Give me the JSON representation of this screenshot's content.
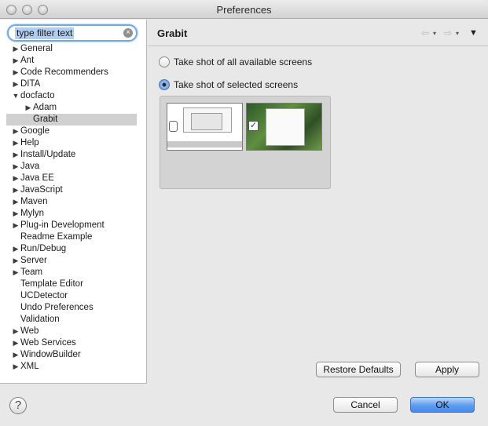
{
  "window": {
    "title": "Preferences"
  },
  "filter": {
    "value": "type filter text"
  },
  "tree": [
    {
      "label": "General",
      "depth": 0,
      "twisty": "collapsed"
    },
    {
      "label": "Ant",
      "depth": 0,
      "twisty": "collapsed"
    },
    {
      "label": "Code Recommenders",
      "depth": 0,
      "twisty": "collapsed"
    },
    {
      "label": "DITA",
      "depth": 0,
      "twisty": "collapsed"
    },
    {
      "label": "docfacto",
      "depth": 0,
      "twisty": "expanded"
    },
    {
      "label": "Adam",
      "depth": 1,
      "twisty": "collapsed"
    },
    {
      "label": "Grabit",
      "depth": 1,
      "twisty": "none",
      "selected": true
    },
    {
      "label": "Google",
      "depth": 0,
      "twisty": "collapsed"
    },
    {
      "label": "Help",
      "depth": 0,
      "twisty": "collapsed"
    },
    {
      "label": "Install/Update",
      "depth": 0,
      "twisty": "collapsed"
    },
    {
      "label": "Java",
      "depth": 0,
      "twisty": "collapsed"
    },
    {
      "label": "Java EE",
      "depth": 0,
      "twisty": "collapsed"
    },
    {
      "label": "JavaScript",
      "depth": 0,
      "twisty": "collapsed"
    },
    {
      "label": "Maven",
      "depth": 0,
      "twisty": "collapsed"
    },
    {
      "label": "Mylyn",
      "depth": 0,
      "twisty": "collapsed"
    },
    {
      "label": "Plug-in Development",
      "depth": 0,
      "twisty": "collapsed"
    },
    {
      "label": "Readme Example",
      "depth": 0,
      "twisty": "none"
    },
    {
      "label": "Run/Debug",
      "depth": 0,
      "twisty": "collapsed"
    },
    {
      "label": "Server",
      "depth": 0,
      "twisty": "collapsed"
    },
    {
      "label": "Team",
      "depth": 0,
      "twisty": "collapsed"
    },
    {
      "label": "Template Editor",
      "depth": 0,
      "twisty": "none"
    },
    {
      "label": "UCDetector",
      "depth": 0,
      "twisty": "none"
    },
    {
      "label": "Undo Preferences",
      "depth": 0,
      "twisty": "none"
    },
    {
      "label": "Validation",
      "depth": 0,
      "twisty": "none"
    },
    {
      "label": "Web",
      "depth": 0,
      "twisty": "collapsed"
    },
    {
      "label": "Web Services",
      "depth": 0,
      "twisty": "collapsed"
    },
    {
      "label": "WindowBuilder",
      "depth": 0,
      "twisty": "collapsed"
    },
    {
      "label": "XML",
      "depth": 0,
      "twisty": "collapsed"
    }
  ],
  "page": {
    "title": "Grabit",
    "nav": {
      "back_icon": "back-arrow-icon",
      "forward_icon": "forward-arrow-icon",
      "menu_icon": "view-menu-icon"
    },
    "options": {
      "all_screens": "Take shot of all available screens",
      "selected_screens": "Take shot of selected screens",
      "selected": "selected_screens"
    },
    "screens": [
      {
        "name": "screen-1",
        "checked": false
      },
      {
        "name": "screen-2",
        "checked": true
      }
    ]
  },
  "buttons": {
    "restore_defaults": "Restore Defaults",
    "apply": "Apply",
    "cancel": "Cancel",
    "ok": "OK",
    "help": "?"
  },
  "colors": {
    "accent": "#5c9cef",
    "selection": "#d0d0d0"
  }
}
